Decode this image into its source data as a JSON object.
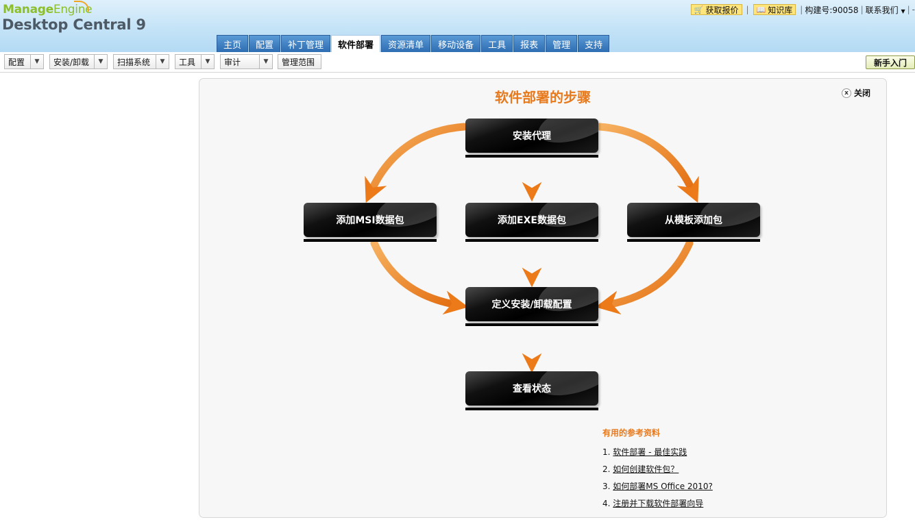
{
  "header": {
    "logo_manage": "Manage",
    "logo_engine": "Engine",
    "product": "Desktop Central 9",
    "links": {
      "quote": "获取报价",
      "kb": "知识库",
      "build": "构建号:90058",
      "contact": "联系我们"
    }
  },
  "tabs": [
    {
      "label": "主页"
    },
    {
      "label": "配置"
    },
    {
      "label": "补丁管理"
    },
    {
      "label": "软件部署",
      "active": true
    },
    {
      "label": "资源清单"
    },
    {
      "label": "移动设备"
    },
    {
      "label": "工具"
    },
    {
      "label": "报表"
    },
    {
      "label": "管理"
    },
    {
      "label": "支持"
    }
  ],
  "toolbar": {
    "menus": [
      "配置",
      "安装/卸载",
      "扫描系统",
      "工具",
      "审计"
    ],
    "manage_scope": "管理范围",
    "newbie": "新手入门"
  },
  "panel": {
    "title": "软件部署的步骤",
    "close": "关闭",
    "steps": {
      "install_agent": "安装代理",
      "add_msi": "添加MSI数据包",
      "add_exe": "添加EXE数据包",
      "from_template": "从模板添加包",
      "define_config": "定义安装/卸载配置",
      "view_status": "查看状态"
    },
    "refs": {
      "title": "有用的参考资料",
      "items": [
        {
          "num": "1.",
          "text": "软件部署 - 最佳实践"
        },
        {
          "num": "2.",
          "text": "如何创建软件包？"
        },
        {
          "num": "3.",
          "text": "如何部署MS Office 2010?"
        },
        {
          "num": "4.",
          "text": "注册并下载软件部署向导"
        }
      ]
    }
  },
  "colors": {
    "accent_orange": "#e87a1e",
    "tab_blue": "#2d6db2"
  }
}
